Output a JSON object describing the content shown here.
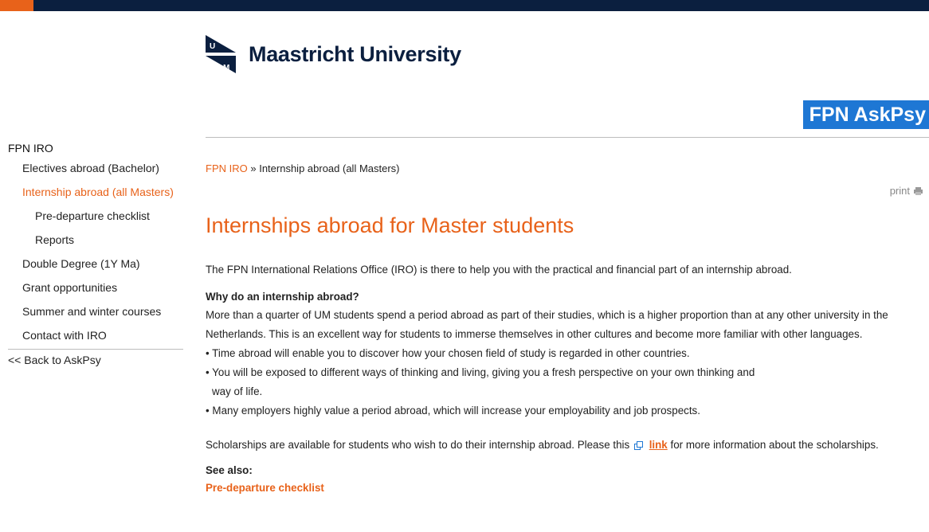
{
  "colors": {
    "accent": "#e8621a",
    "navy": "#0b1f3f",
    "badge": "#1e77d4"
  },
  "header": {
    "university_name": "Maastricht University",
    "logo_letters": "UM",
    "site_badge": "FPN AskPsy"
  },
  "sidebar": {
    "title": "FPN IRO",
    "items": [
      {
        "label": "Electives abroad (Bachelor)"
      },
      {
        "label": "Internship abroad (all Masters)"
      },
      {
        "label": "Pre-departure checklist"
      },
      {
        "label": "Reports"
      },
      {
        "label": "Double Degree (1Y Ma)"
      },
      {
        "label": "Grant opportunities"
      },
      {
        "label": "Summer and winter courses"
      },
      {
        "label": "Contact with IRO"
      }
    ],
    "back_link": "<< Back to AskPsy"
  },
  "breadcrumb": {
    "root": "FPN IRO",
    "separator": " » ",
    "current": "Internship abroad (all Masters)"
  },
  "print": {
    "label": "print",
    "icon": "printer-icon"
  },
  "main": {
    "title": "Internships abroad for Master students",
    "intro": "The FPN International Relations Office (IRO) is there to help you with the practical and financial part of an internship abroad.",
    "why_heading": "Why do an internship abroad?",
    "para_line1": "More than a quarter of UM students spend a period abroad as part of their studies, which is a higher proportion than at any other university in the",
    "para_line2": "Netherlands. This is an excellent way for students to immerse themselves in other cultures and become more familiar with other languages.",
    "bullet1": "• Time abroad will enable you to discover how your chosen field of study is regarded in other countries.",
    "bullet2a": "• You will be exposed to different ways of thinking and living, giving you a fresh perspective on your own thinking and",
    "bullet2b": "way of life.",
    "bullet3": "• Many employers highly value a period abroad, which will increase your employability and job prospects.",
    "scholar_before": "Scholarships are available for students who wish to do their internship abroad. Please this",
    "scholar_link": "link",
    "scholar_after": "for more information about the scholarships.",
    "see_also_heading": "See also:",
    "see_also_link": "Pre-departure checklist"
  }
}
